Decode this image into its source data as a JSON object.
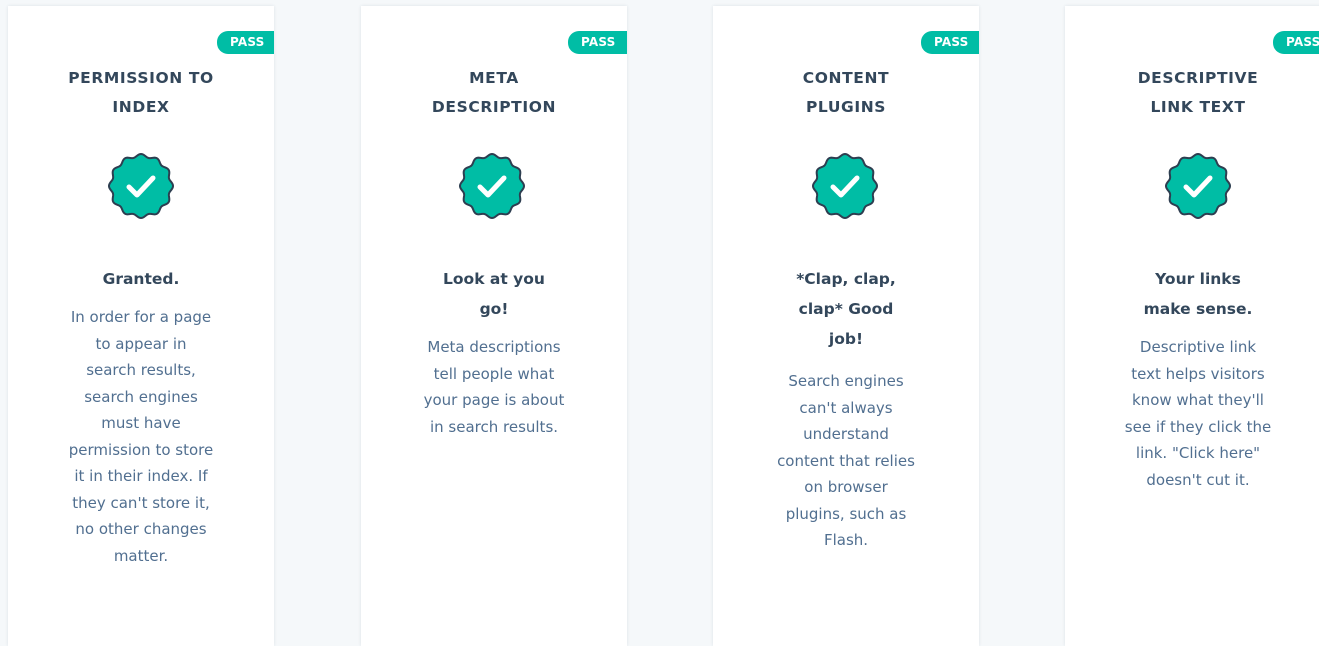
{
  "colors": {
    "accent": "#00bda5",
    "heading": "#33475b",
    "body": "#516f90",
    "background": "#f5f8fa"
  },
  "cards": [
    {
      "status": "PASS",
      "title": "PERMISSION TO\nINDEX",
      "icon": "check-badge-icon",
      "headline": "Granted.",
      "description": "In order for a page\nto appear in\nsearch results,\nsearch engines\nmust have\npermission to store\nit in their index. If\nthey can't store it,\nno other changes\nmatter."
    },
    {
      "status": "PASS",
      "title": "META\nDESCRIPTION",
      "icon": "check-badge-icon",
      "headline": "Look at you\ngo!",
      "description": "Meta descriptions\ntell people what\nyour page is about\nin search results."
    },
    {
      "status": "PASS",
      "title": "CONTENT\nPLUGINS",
      "icon": "check-badge-icon",
      "headline": "*Clap, clap,\nclap* Good\njob!",
      "description": "Search engines\ncan't always\nunderstand\ncontent that relies\non browser\nplugins, such as\nFlash."
    },
    {
      "status": "PASS",
      "title": "DESCRIPTIVE\nLINK TEXT",
      "icon": "check-badge-icon",
      "headline": "Your links\nmake sense.",
      "description": "Descriptive link\ntext helps visitors\nknow what they'll\nsee if they click the\nlink. \"Click here\"\ndoesn't cut it."
    }
  ]
}
